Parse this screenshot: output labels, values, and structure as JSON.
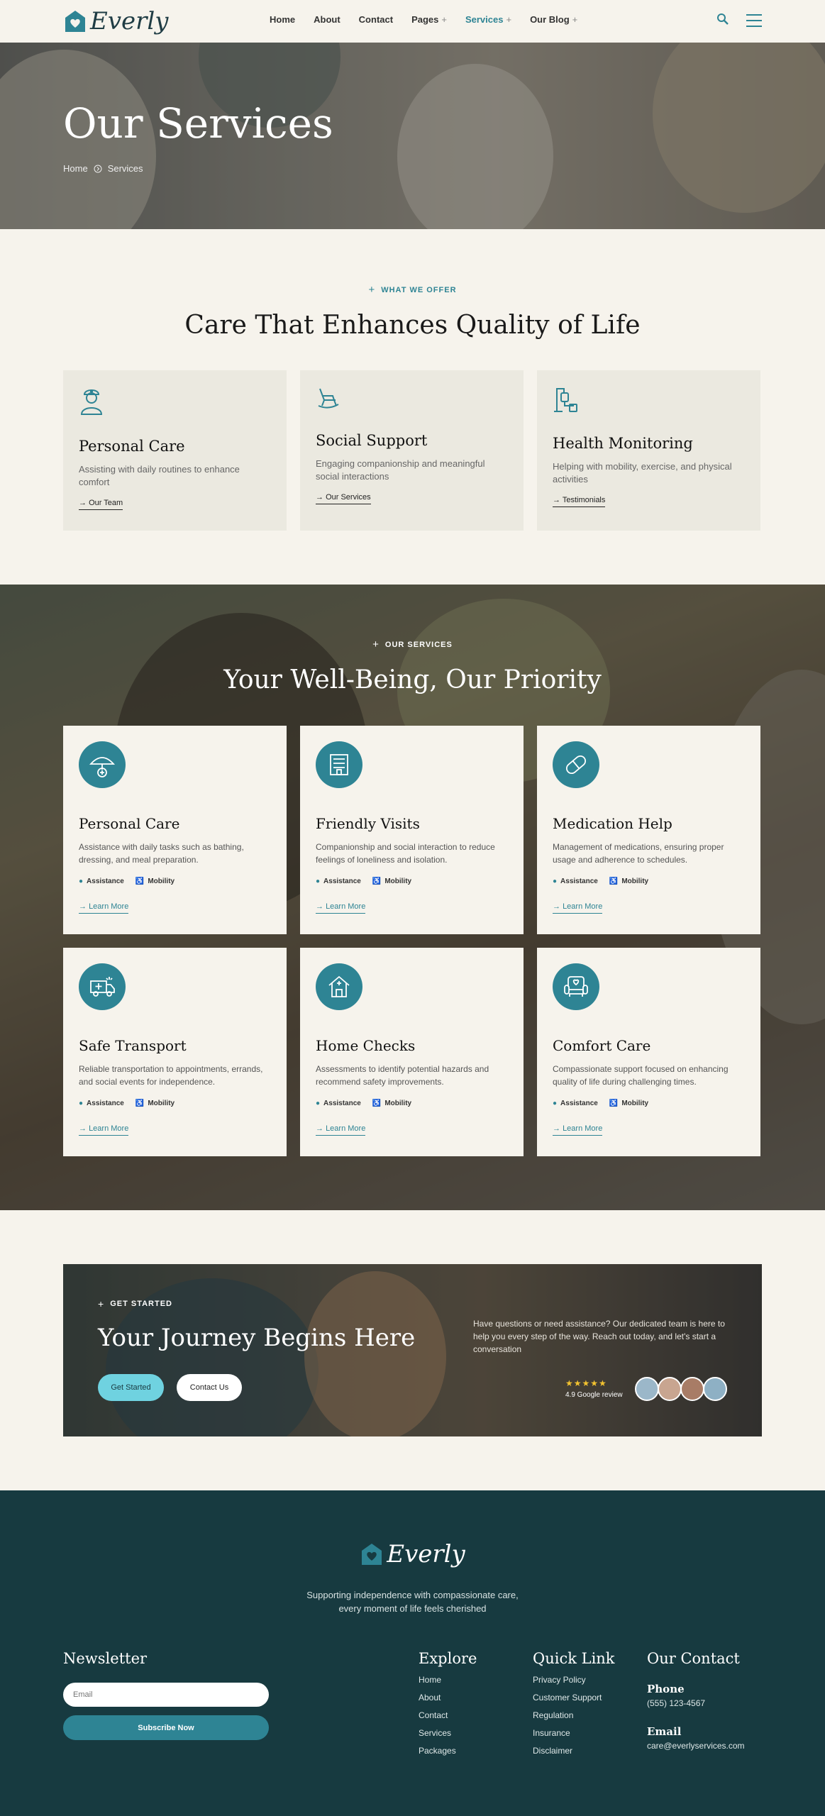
{
  "header": {
    "logo": "Everly",
    "nav": [
      {
        "label": "Home",
        "plus": false,
        "active": false
      },
      {
        "label": "About",
        "plus": false,
        "active": false
      },
      {
        "label": "Contact",
        "plus": false,
        "active": false
      },
      {
        "label": "Pages",
        "plus": true,
        "active": false
      },
      {
        "label": "Services",
        "plus": true,
        "active": true
      },
      {
        "label": "Our Blog",
        "plus": true,
        "active": false
      }
    ],
    "search_icon": "search-icon",
    "menu_icon": "hamburger-icon"
  },
  "hero": {
    "title": "Our Services",
    "breadcrumb": {
      "home": "Home",
      "current": "Services"
    }
  },
  "offer": {
    "eyebrow": "WHAT WE OFFER",
    "title": "Care That Enhances Quality of Life",
    "cards": [
      {
        "title": "Personal Care",
        "text": "Assisting with daily routines to enhance comfort",
        "link": "Our Team",
        "icon": "nurse-icon"
      },
      {
        "title": "Social Support",
        "text": "Engaging companionship and meaningful social interactions",
        "link": "Our Services",
        "icon": "rocking-chair-icon"
      },
      {
        "title": "Health Monitoring",
        "text": "Helping with mobility, exercise, and physical activities",
        "link": "Testimonials",
        "icon": "iv-drip-icon"
      }
    ]
  },
  "services": {
    "eyebrow": "OUR SERVICES",
    "title": "Your Well-Being, Our Priority",
    "tag1": "Assistance",
    "tag2": "Mobility",
    "link": "Learn More",
    "cards": [
      {
        "title": "Personal Care",
        "text": "Assistance with daily tasks such as bathing, dressing, and meal preparation.",
        "icon": "umbrella-icon"
      },
      {
        "title": "Friendly Visits",
        "text": "Companionship and social interaction to reduce feelings of loneliness and isolation.",
        "icon": "building-icon"
      },
      {
        "title": "Medication Help",
        "text": "Management of medications, ensuring proper usage and adherence to schedules.",
        "icon": "pill-icon"
      },
      {
        "title": "Safe Transport",
        "text": "Reliable transportation to appointments, errands, and social events for independence.",
        "icon": "ambulance-icon"
      },
      {
        "title": "Home Checks",
        "text": "Assessments to identify potential hazards and recommend safety improvements.",
        "icon": "house-icon"
      },
      {
        "title": "Comfort Care",
        "text": "Compassionate support focused on enhancing quality of life during challenging times.",
        "icon": "armchair-icon"
      }
    ]
  },
  "cta": {
    "eyebrow": "GET STARTED",
    "title": "Your Journey Begins Here",
    "text": "Have questions or need assistance? Our dedicated team is here to help you every step of the way. Reach out today, and let's start a conversation",
    "btn_primary": "Get Started",
    "btn_secondary": "Contact Us",
    "rating_stars": 5,
    "review": "4.9 Google review"
  },
  "footer": {
    "logo": "Everly",
    "tagline1": "Supporting independence with compassionate care,",
    "tagline2": "every moment of life feels cherished",
    "newsletter": {
      "title": "Newsletter",
      "placeholder": "Email",
      "button": "Subscribe Now"
    },
    "explore": {
      "title": "Explore",
      "items": [
        "Home",
        "About",
        "Contact",
        "Services",
        "Packages"
      ]
    },
    "quick": {
      "title": "Quick Link",
      "items": [
        "Privacy Policy",
        "Customer Support",
        "Regulation",
        "Insurance",
        "Disclaimer"
      ]
    },
    "contact": {
      "title": "Our Contact",
      "phone_label": "Phone",
      "phone": "(555) 123-4567",
      "email_label": "Email",
      "email": "care@everlyservices.com"
    }
  },
  "colors": {
    "accent": "#2e8494",
    "footer_bg": "#173a40",
    "cream": "#f6f3ec",
    "cta_button": "#6fd2e0"
  }
}
